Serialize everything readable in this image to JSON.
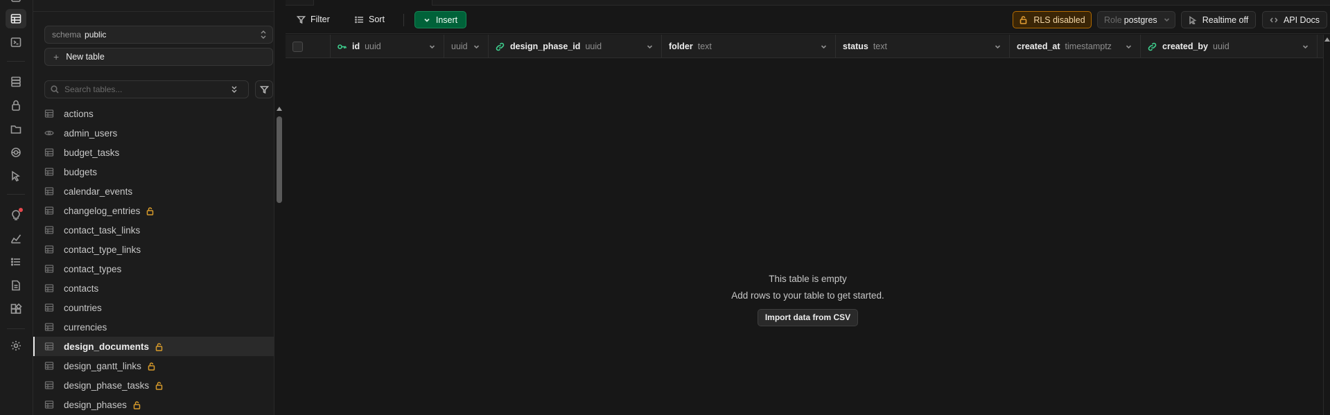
{
  "colors": {
    "accent_green": "#006239",
    "rls_warning": "#b36b00",
    "lock_orange": "#d69a2b",
    "key_green": "#3ecf8e"
  },
  "rail": {
    "items": [
      "table-editor-icon",
      "sql-editor-icon",
      "database-icon",
      "auth-icon",
      "storage-icon",
      "edge-functions-icon",
      "realtime-icon",
      "advisors-icon",
      "reports-icon",
      "logs-icon",
      "api-docs-icon",
      "integrations-icon",
      "settings-icon"
    ]
  },
  "sidebar": {
    "schema_label": "schema",
    "schema_value": "public",
    "new_table_label": "New table",
    "search_placeholder": "Search tables...",
    "tables": [
      {
        "name": "actions",
        "icon": "table-icon",
        "locked": false,
        "active": false
      },
      {
        "name": "admin_users",
        "icon": "view-icon",
        "locked": false,
        "active": false
      },
      {
        "name": "budget_tasks",
        "icon": "table-icon",
        "locked": false,
        "active": false
      },
      {
        "name": "budgets",
        "icon": "table-icon",
        "locked": false,
        "active": false
      },
      {
        "name": "calendar_events",
        "icon": "table-icon",
        "locked": false,
        "active": false
      },
      {
        "name": "changelog_entries",
        "icon": "table-icon",
        "locked": true,
        "active": false
      },
      {
        "name": "contact_task_links",
        "icon": "table-icon",
        "locked": false,
        "active": false
      },
      {
        "name": "contact_type_links",
        "icon": "table-icon",
        "locked": false,
        "active": false
      },
      {
        "name": "contact_types",
        "icon": "table-icon",
        "locked": false,
        "active": false
      },
      {
        "name": "contacts",
        "icon": "table-icon",
        "locked": false,
        "active": false
      },
      {
        "name": "countries",
        "icon": "table-icon",
        "locked": false,
        "active": false
      },
      {
        "name": "currencies",
        "icon": "table-icon",
        "locked": false,
        "active": false
      },
      {
        "name": "design_documents",
        "icon": "table-icon",
        "locked": true,
        "active": true
      },
      {
        "name": "design_gantt_links",
        "icon": "table-icon",
        "locked": true,
        "active": false
      },
      {
        "name": "design_phase_tasks",
        "icon": "table-icon",
        "locked": true,
        "active": false
      },
      {
        "name": "design_phases",
        "icon": "table-icon",
        "locked": true,
        "active": false
      }
    ]
  },
  "toolbar": {
    "filter_label": "Filter",
    "sort_label": "Sort",
    "insert_label": "Insert",
    "rls_label": "RLS disabled",
    "role_label": "Role",
    "role_value": "postgres",
    "realtime_label": "Realtime off",
    "api_docs_label": "API Docs"
  },
  "columns": [
    {
      "name": "id",
      "type": "uuid",
      "icon": "key-icon"
    },
    {
      "name": "",
      "type": "uuid",
      "icon": ""
    },
    {
      "name": "design_phase_id",
      "type": "uuid",
      "icon": "link-icon"
    },
    {
      "name": "folder",
      "type": "text",
      "icon": ""
    },
    {
      "name": "status",
      "type": "text",
      "icon": ""
    },
    {
      "name": "created_at",
      "type": "timestamptz",
      "icon": ""
    },
    {
      "name": "created_by",
      "type": "uuid",
      "icon": "link-icon"
    }
  ],
  "empty_state": {
    "title": "This table is empty",
    "subtitle": "Add rows to your table to get started.",
    "import_label": "Import data from CSV"
  }
}
